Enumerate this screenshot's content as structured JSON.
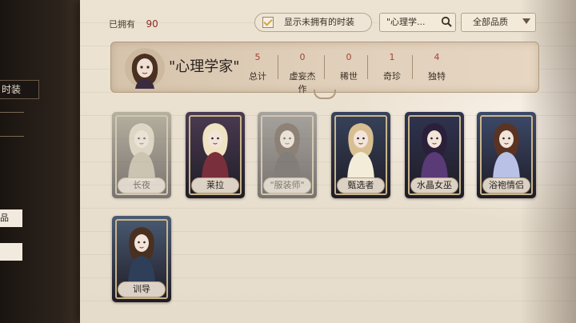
{
  "header": {
    "owned_label": "已拥有",
    "owned_count": "90",
    "toggle_label": "显示未拥有的时装",
    "search_value": "\"心理学...",
    "filter_value": "全部品质"
  },
  "banner": {
    "title": "\"心理学家\"",
    "stats": [
      {
        "n": "5",
        "label": "总计"
      },
      {
        "n": "0",
        "label": "虚妄杰作"
      },
      {
        "n": "0",
        "label": "稀世"
      },
      {
        "n": "1",
        "label": "奇珍"
      },
      {
        "n": "4",
        "label": "独特"
      }
    ]
  },
  "sidebar": {
    "tab_label": "时装",
    "item_label": "品"
  },
  "cards": [
    {
      "label": "长夜",
      "bg": "#8e8a6e",
      "dress": "#b6ae88",
      "hair": "#d9cfb0",
      "dim": true
    },
    {
      "label": "莱拉",
      "bg": "#4b3b52",
      "dress": "#7a2f3c",
      "hair": "#efe3c2",
      "dim": false
    },
    {
      "label": "\"服装师\"",
      "bg": "#6f7177",
      "dress": "#2f2f3a",
      "hair": "#4b3325",
      "dim": true
    },
    {
      "label": "甄选者",
      "bg": "#37435c",
      "dress": "#f3ecd9",
      "hair": "#d8bf92",
      "dim": false
    },
    {
      "label": "水晶女巫",
      "bg": "#2f3450",
      "dress": "#5b3a78",
      "hair": "#2b1f3a",
      "dim": false
    },
    {
      "label": "浴袍情侣",
      "bg": "#3c4a6a",
      "dress": "#b9c2e6",
      "hair": "#5a3323",
      "dim": false
    },
    {
      "label": "训导",
      "bg": "#4a5b73",
      "dress": "#2f3f59",
      "hair": "#4a3020",
      "dim": false
    }
  ]
}
